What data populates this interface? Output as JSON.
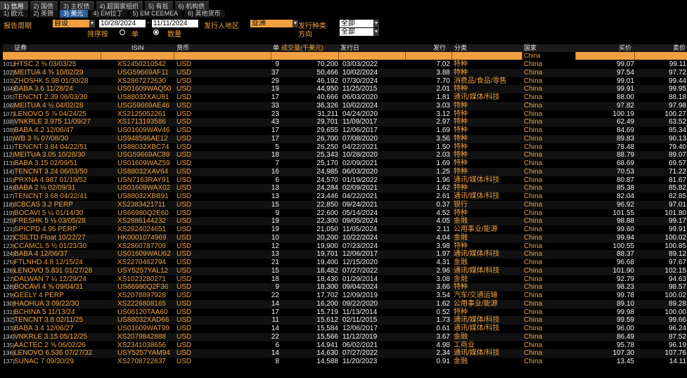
{
  "tabs_top": [
    "1) 信用",
    "2) 国债",
    "3) 主权债",
    "4) 超国家组织",
    "5) 有抵",
    "6) 机构债"
  ],
  "tabs_sub": [
    "1) 欧元",
    "2) 英镑",
    "3) 美元",
    "4) EM拉丁",
    "5) EM CEEMEA",
    "6) 其他货币"
  ],
  "controls": {
    "report_period_label": "报告周期",
    "report_period_value": "自设",
    "date_from": "10/28/2024",
    "date_sep": "-",
    "date_to": "11/11/2024",
    "issuer_region_label": "发行人地区",
    "issuer_region_value": "亚洲",
    "issue_type_label": "发行种类",
    "issue_type_value": "全部",
    "sort_label": "排序按",
    "sort_option1": "单",
    "sort_option2": "数量",
    "direction_label": "方向",
    "direction_value": "全部"
  },
  "columns": [
    "证券",
    "ISIN",
    "货币",
    "单",
    "成交量(千美元)",
    "发行日",
    "发行",
    "分类",
    "国家",
    "买价",
    "卖价"
  ],
  "filter": {
    "country": "China"
  },
  "colors": {
    "accent": "#f0a040",
    "background": "#000000",
    "active_tab": "#2d5d9a"
  },
  "rows": [
    {
      "idx": "101)",
      "sec": "HTSC 2 ⅜ 03/03/25",
      "isin": "XS2450210542",
      "ccy": "USD",
      "n": "9",
      "vol": "70,200",
      "date": "03/03/2022",
      "amt": "7.02",
      "cat": "特种",
      "country": "China",
      "bid": "99.07",
      "ask": "99.11"
    },
    {
      "idx": "102)",
      "sec": "MEITUA 4 ⅝ 10/02/29",
      "isin": "USG59669AF11",
      "ccy": "USD",
      "n": "37",
      "vol": "50,466",
      "date": "10/02/2024",
      "amt": "3.88",
      "cat": "特种",
      "country": "China",
      "bid": "97.54",
      "ask": "97.72"
    },
    {
      "idx": "103)",
      "sec": "ZHOSHK 5.98 01/30/28",
      "isin": "XS2867272630",
      "ccy": "USD",
      "n": "29",
      "vol": "46,192",
      "date": "07/30/2024",
      "amt": "7.70",
      "cat": "消费品/食品/零售",
      "country": "China",
      "bid": "99.01",
      "ask": "99.44"
    },
    {
      "idx": "104)",
      "sec": "BABA 3.6 11/28/24",
      "isin": "US01609WAQ50",
      "ccy": "USD",
      "n": "19",
      "vol": "44,950",
      "date": "11/25/2015",
      "amt": "2.01",
      "cat": "特种",
      "country": "China",
      "bid": "99.91",
      "ask": "99.95"
    },
    {
      "idx": "105)",
      "sec": "TENCNT 2.39 06/03/30",
      "isin": "US88032XAU81",
      "ccy": "USD",
      "n": "17",
      "vol": "40,666",
      "date": "06/03/2020",
      "amt": "1.81",
      "cat": "通讯/媒体/科技",
      "country": "China",
      "bid": "88.00",
      "ask": "88.18"
    },
    {
      "idx": "106)",
      "sec": "MEITUA 4 ½ 04/02/28",
      "isin": "USG59669AE46",
      "ccy": "USD",
      "n": "33",
      "vol": "36,326",
      "date": "10/02/2024",
      "amt": "3.03",
      "cat": "特种",
      "country": "China",
      "bid": "97.82",
      "ask": "97.98"
    },
    {
      "idx": "107)",
      "sec": "LENOVO 5 ⅞ 04/24/25",
      "isin": "XS2125052261",
      "ccy": "USD",
      "n": "23",
      "vol": "31,211",
      "date": "04/24/2020",
      "amt": "3.12",
      "cat": "特种",
      "country": "China",
      "bid": "100.19",
      "ask": "100.27"
    },
    {
      "idx": "108)",
      "sec": "VNKRLE 3.975 11/09/27",
      "isin": "XS1713193586",
      "ccy": "USD",
      "n": "43",
      "vol": "29,701",
      "date": "11/09/2017",
      "amt": "2.97",
      "cat": "特种",
      "country": "China",
      "bid": "62.49",
      "ask": "63.52"
    },
    {
      "idx": "109)",
      "sec": "BABA 4.2 12/06/47",
      "isin": "US01609WAV46",
      "ccy": "USD",
      "n": "17",
      "vol": "29,655",
      "date": "12/06/2017",
      "amt": "1.69",
      "cat": "特种",
      "country": "China",
      "bid": "84.69",
      "ask": "85.34"
    },
    {
      "idx": "110)",
      "sec": "WB 3 ⅜ 07/08/30",
      "isin": "US948596AE12",
      "ccy": "USD",
      "n": "17",
      "vol": "26,700",
      "date": "07/08/2020",
      "amt": "3.56",
      "cat": "特种",
      "country": "China",
      "bid": "89.83",
      "ask": "90.13"
    },
    {
      "idx": "111)",
      "sec": "TENCNT 3.84 04/22/51",
      "isin": "US88032XBC74",
      "ccy": "USD",
      "n": "5",
      "vol": "26,250",
      "date": "04/22/2021",
      "amt": "1.50",
      "cat": "特种",
      "country": "China",
      "bid": "78.48",
      "ask": "79.40"
    },
    {
      "idx": "112)",
      "sec": "MEITUA 3.05 10/28/30",
      "isin": "USG59669AC89",
      "ccy": "USD",
      "n": "18",
      "vol": "25,343",
      "date": "10/28/2020",
      "amt": "2.03",
      "cat": "特种",
      "country": "China",
      "bid": "88.79",
      "ask": "89.07"
    },
    {
      "idx": "113)",
      "sec": "BABA 3.15 02/09/51",
      "isin": "US01609WAZ59",
      "ccy": "USD",
      "n": "7",
      "vol": "25,170",
      "date": "02/09/2021",
      "amt": "1.69",
      "cat": "特种",
      "country": "China",
      "bid": "68.69",
      "ask": "69.57"
    },
    {
      "idx": "114)",
      "sec": "TENCNT 3.24 06/03/50",
      "isin": "US88032XAV64",
      "ccy": "USD",
      "n": "16",
      "vol": "24,985",
      "date": "06/03/2020",
      "amt": "1.25",
      "cat": "特种",
      "country": "China",
      "bid": "70.53",
      "ask": "71.22"
    },
    {
      "idx": "115)",
      "sec": "PRXNA 4.987 01/19/52",
      "isin": "USN7163RAY91",
      "ccy": "USD",
      "n": "6",
      "vol": "24,570",
      "date": "01/19/2022",
      "amt": "1.96",
      "cat": "通讯/媒体/科技",
      "country": "China",
      "bid": "80.87",
      "ask": "81.67"
    },
    {
      "idx": "116)",
      "sec": "BABA 2 ⅛ 02/09/31",
      "isin": "US01609WAX02",
      "ccy": "USD",
      "n": "13",
      "vol": "24,284",
      "date": "02/09/2021",
      "amt": "1.62",
      "cat": "特种",
      "country": "China",
      "bid": "85.38",
      "ask": "85.82"
    },
    {
      "idx": "117)",
      "sec": "TENCNT 3.68 04/22/41",
      "isin": "US88032XBB91",
      "ccy": "USD",
      "n": "13",
      "vol": "23,446",
      "date": "04/22/2021",
      "amt": "2.61",
      "cat": "通讯/媒体/科技",
      "country": "China",
      "bid": "82.04",
      "ask": "82.85"
    },
    {
      "idx": "118)",
      "sec": "ICBCAS 3.2 PERP",
      "isin": "XS2383421711",
      "ccy": "USD",
      "n": "15",
      "vol": "22,850",
      "date": "09/24/2021",
      "amt": "0.37",
      "cat": "银行",
      "country": "China",
      "bid": "96.92",
      "ask": "97.01"
    },
    {
      "idx": "119)",
      "sec": "BOCAVI 5 ¼ 01/14/30",
      "isin": "US66980Q2E60",
      "ccy": "USD",
      "n": "9",
      "vol": "22,600",
      "date": "05/14/2024",
      "amt": "4.52",
      "cat": "特种",
      "country": "China",
      "bid": "101.55",
      "ask": "101.80"
    },
    {
      "idx": "120)",
      "sec": "FRESHK 5 ⅛ 03/05/28",
      "isin": "XS2886144232",
      "ccy": "USD",
      "n": "19",
      "vol": "22,300",
      "date": "09/05/2024",
      "amt": "4.05",
      "cat": "金融",
      "country": "China",
      "bid": "98.88",
      "ask": "99.17"
    },
    {
      "idx": "121)",
      "sec": "SPICPD 4.95 PERP",
      "isin": "XS2924024651",
      "ccy": "USD",
      "n": "19",
      "vol": "21,050",
      "date": "11/05/2024",
      "amt": "2.11",
      "cat": "公用事业/能源",
      "country": "China",
      "bid": "99.60",
      "ask": "99.91"
    },
    {
      "idx": "122)",
      "sec": "CSILTD Float 10/22/27",
      "isin": "HK0001074969",
      "ccy": "USD",
      "n": "10",
      "vol": "20,200",
      "date": "10/22/2024",
      "amt": "4.04",
      "cat": "金融",
      "country": "China",
      "bid": "99.94",
      "ask": "100.02"
    },
    {
      "idx": "123)",
      "sec": "CCAMCL 5 ½ 01/23/30",
      "isin": "XS2860787709",
      "ccy": "USD",
      "n": "12",
      "vol": "19,900",
      "date": "07/23/2024",
      "amt": "3.98",
      "cat": "特种",
      "country": "China",
      "bid": "100.55",
      "ask": "100.85"
    },
    {
      "idx": "124)",
      "sec": "BABA 4 12/06/37",
      "isin": "US01609WAU62",
      "ccy": "USD",
      "n": "13",
      "vol": "19,701",
      "date": "12/06/2017",
      "amt": "1.97",
      "cat": "通讯/媒体/科技",
      "country": "China",
      "bid": "88.37",
      "ask": "89.12"
    },
    {
      "idx": "125)",
      "sec": "FTLNHD 4.8 12/15/24",
      "isin": "XS2270462794",
      "ccy": "USD",
      "n": "21",
      "vol": "19,400",
      "date": "12/15/2020",
      "amt": "4.31",
      "cat": "金融",
      "country": "China",
      "bid": "96.68",
      "ask": "97.67"
    },
    {
      "idx": "126)",
      "sec": "LENOVO 5.831 01/27/28",
      "isin": "USY5257YAL12",
      "ccy": "USD",
      "n": "15",
      "vol": "18,482",
      "date": "07/27/2022",
      "amt": "2.96",
      "cat": "通讯/媒体/科技",
      "country": "China",
      "bid": "101.90",
      "ask": "102.15"
    },
    {
      "idx": "127)",
      "sec": "DALWAN 7 ¼ 12/29/24",
      "isin": "XS1023280271",
      "ccy": "USD",
      "n": "18",
      "vol": "18,430",
      "date": "01/29/2014",
      "amt": "3.08",
      "cat": "金融",
      "country": "China",
      "bid": "92.79",
      "ask": "94.63"
    },
    {
      "idx": "128)",
      "sec": "BOCAVI 4 ⅝ 09/04/31",
      "isin": "US66980Q2F36",
      "ccy": "USD",
      "n": "9",
      "vol": "18,300",
      "date": "09/04/2024",
      "amt": "3.66",
      "cat": "特种",
      "country": "China",
      "bid": "98.23",
      "ask": "98.57"
    },
    {
      "idx": "129)",
      "sec": "GEELY 4 PERP",
      "isin": "XS2078897928",
      "ccy": "USD",
      "n": "22",
      "vol": "17,702",
      "date": "12/09/2019",
      "amt": "3.54",
      "cat": "汽车/交通运输",
      "country": "China",
      "bid": "99.78",
      "ask": "100.02"
    },
    {
      "idx": "130)",
      "sec": "HAOHUA 3 09/22/30",
      "isin": "XS2226808165",
      "ccy": "USD",
      "n": "14",
      "vol": "16,200",
      "date": "09/22/2020",
      "amt": "1.62",
      "cat": "公用事业/能源",
      "country": "China",
      "bid": "89.10",
      "ask": "89.28"
    },
    {
      "idx": "131)",
      "sec": "BCHINA 5 11/13/24",
      "isin": "US06120TAA60",
      "ccy": "USD",
      "n": "17",
      "vol": "15,719",
      "date": "11/13/2014",
      "amt": "0.52",
      "cat": "特种",
      "country": "China",
      "bid": "99.98",
      "ask": "100.00"
    },
    {
      "idx": "132)",
      "sec": "TENCNT 3.8 02/11/25",
      "isin": "US88032XAD66",
      "ccy": "USD",
      "n": "11",
      "vol": "15,612",
      "date": "02/11/2015",
      "amt": "1.73",
      "cat": "通讯/媒体/科技",
      "country": "China",
      "bid": "99.59",
      "ask": "99.66"
    },
    {
      "idx": "133)",
      "sec": "BABA 3.4 12/06/27",
      "isin": "US01609WAT99",
      "ccy": "USD",
      "n": "14",
      "vol": "15,584",
      "date": "12/06/2017",
      "amt": "0.61",
      "cat": "通讯/媒体/科技",
      "country": "China",
      "bid": "96.00",
      "ask": "96.24"
    },
    {
      "idx": "134)",
      "sec": "VNKRLE 3.15 05/12/25",
      "isin": "XS2079842888",
      "ccy": "USD",
      "n": "22",
      "vol": "15,566",
      "date": "11/12/2019",
      "amt": "3.67",
      "cat": "金融",
      "country": "China",
      "bid": "86.49",
      "ask": "87.52"
    },
    {
      "idx": "135)",
      "sec": "AACTEC 2 ⅝ 06/02/26",
      "isin": "XS2341038656",
      "ccy": "USD",
      "n": "6",
      "vol": "14,941",
      "date": "06/02/2021",
      "amt": "4.98",
      "cat": "工商业",
      "country": "China",
      "bid": "95.78",
      "ask": "96.19"
    },
    {
      "idx": "136)",
      "sec": "LENOVO 6.536 07/27/32",
      "isin": "USY5257YAM94",
      "ccy": "USD",
      "n": "14",
      "vol": "14,630",
      "date": "07/27/2022",
      "amt": "2.34",
      "cat": "通讯/媒体/科技",
      "country": "China",
      "bid": "107.30",
      "ask": "107.76"
    },
    {
      "idx": "137)",
      "sec": "SUNAC 7 09/30/29",
      "isin": "XS2708722637",
      "ccy": "USD",
      "n": "8",
      "vol": "14,588",
      "date": "11/20/2023",
      "amt": "0.91",
      "cat": "金融",
      "country": "China",
      "bid": "13.45",
      "ask": "14.11"
    }
  ]
}
